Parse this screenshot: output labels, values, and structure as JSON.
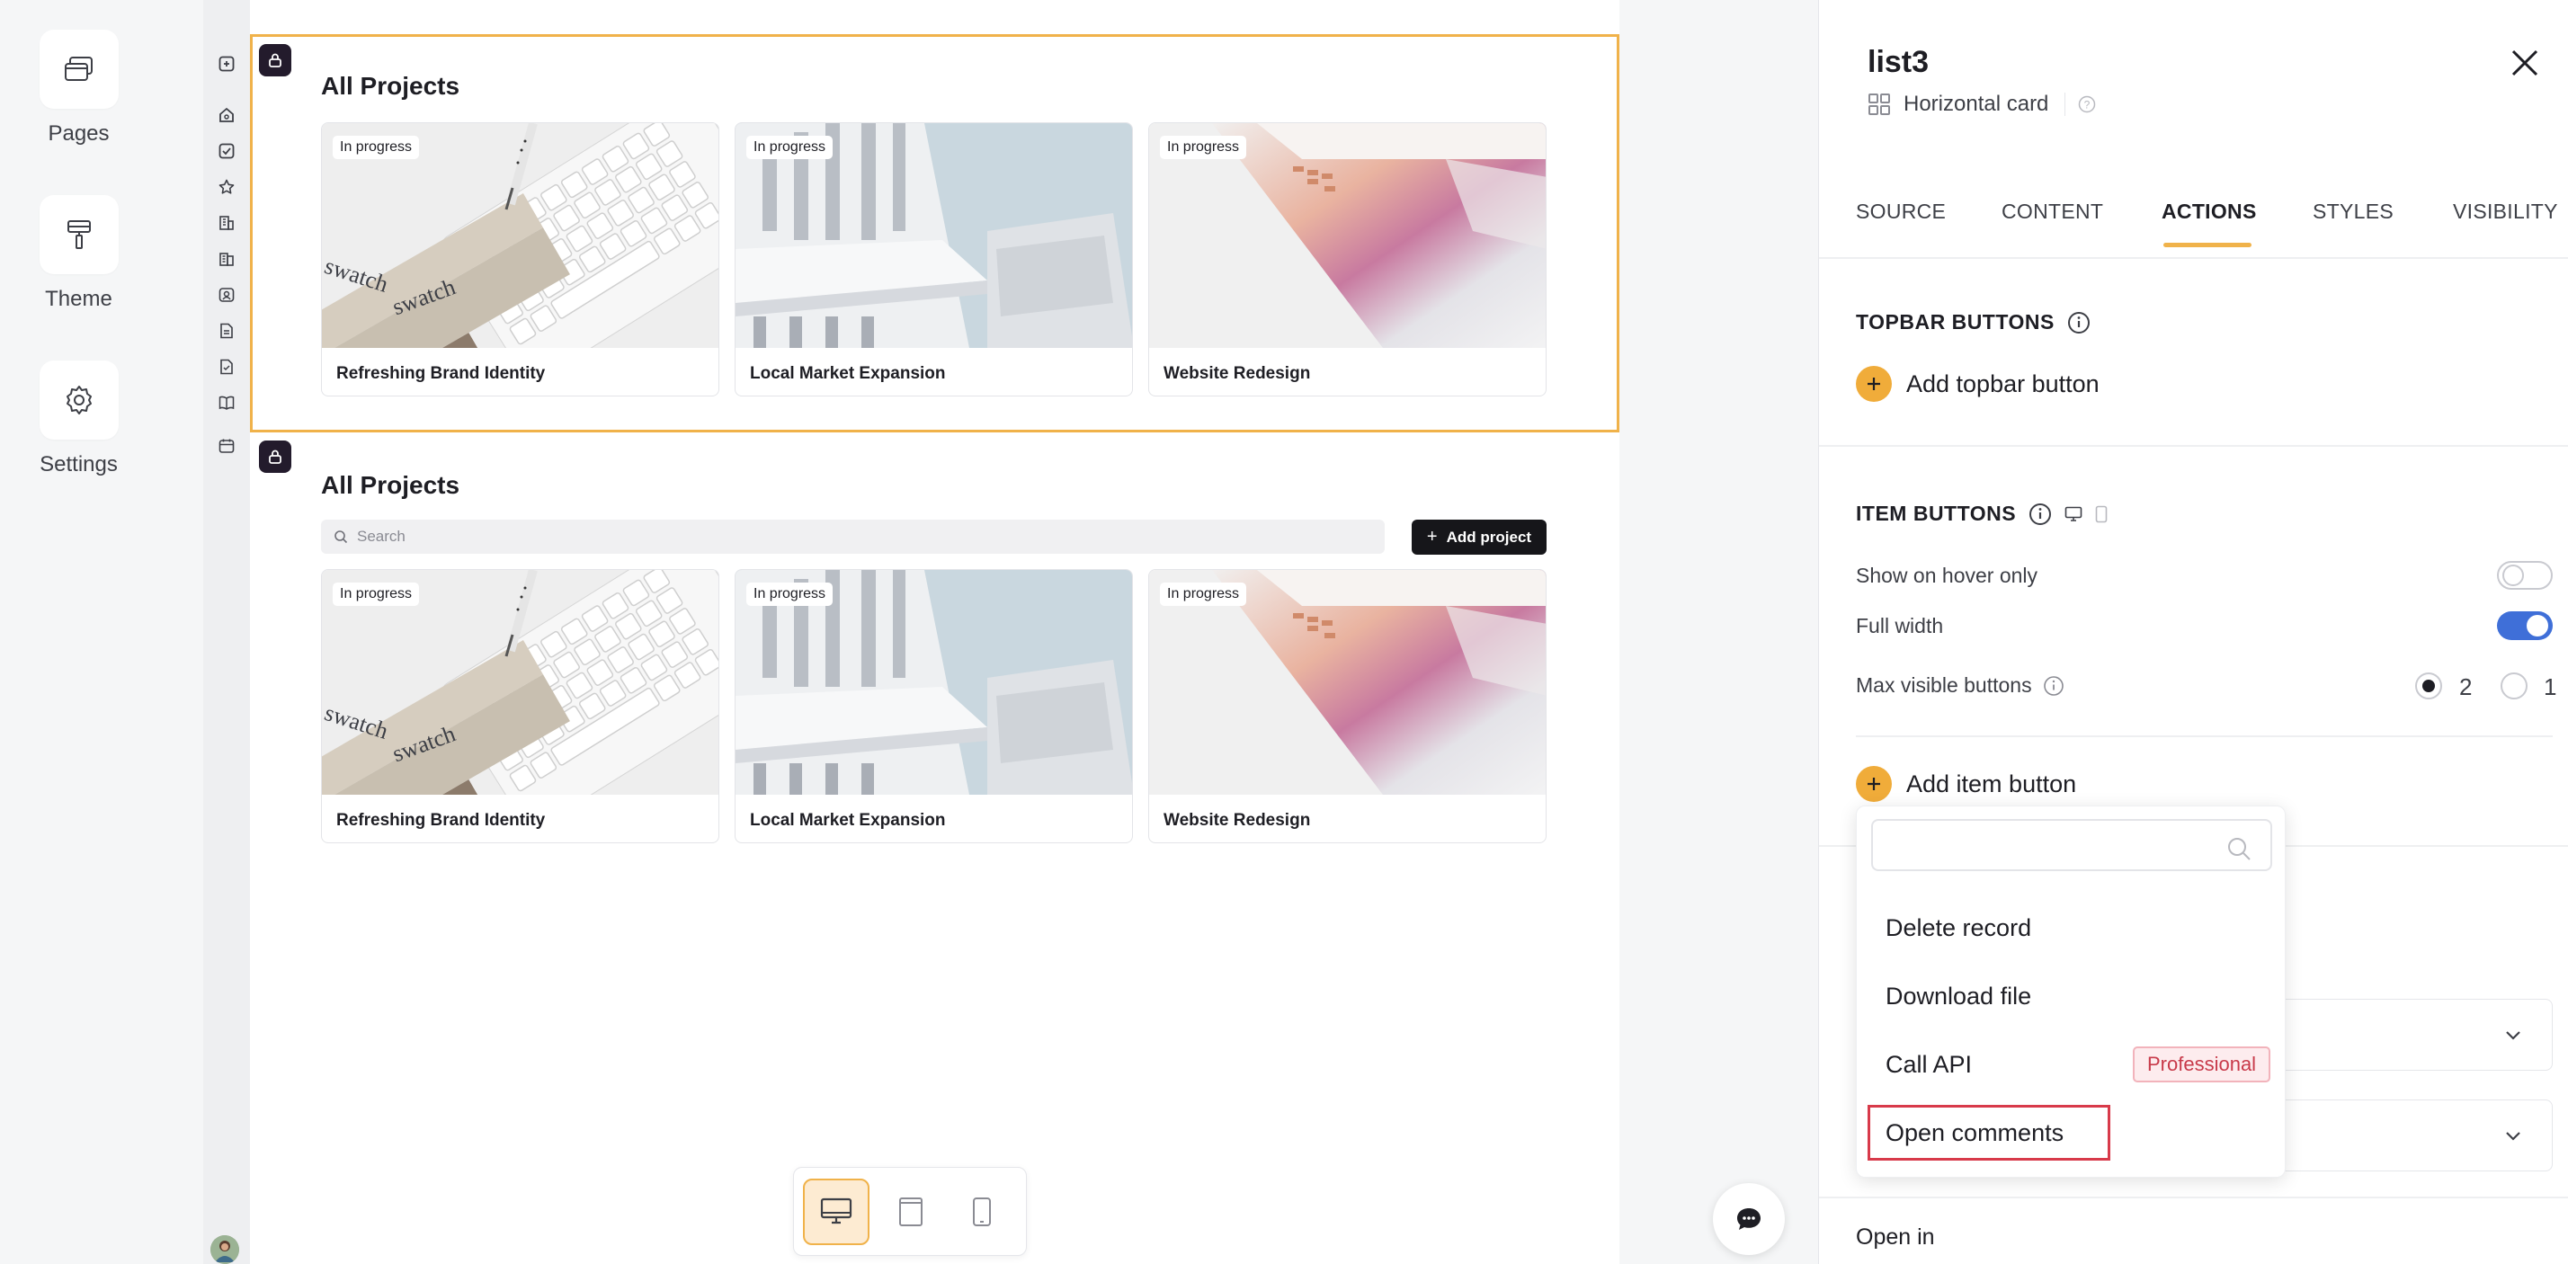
{
  "rail": {
    "pages": "Pages",
    "theme": "Theme",
    "settings": "Settings"
  },
  "blocks": [
    {
      "title": "All Projects",
      "cards": [
        {
          "badge": "In progress",
          "title": "Refreshing Brand Identity",
          "image": "keyboard-swatch-image"
        },
        {
          "badge": "In progress",
          "title": "Local Market Expansion",
          "image": "building-image"
        },
        {
          "badge": "In progress",
          "title": "Website Redesign",
          "image": "laptop-image"
        }
      ]
    },
    {
      "title": "All Projects",
      "search_placeholder": "Search",
      "add_button": "Add project",
      "cards": [
        {
          "badge": "In progress",
          "title": "Refreshing Brand Identity",
          "image": "keyboard-swatch-image"
        },
        {
          "badge": "In progress",
          "title": "Local Market Expansion",
          "image": "building-image"
        },
        {
          "badge": "In progress",
          "title": "Website Redesign",
          "image": "laptop-image"
        }
      ]
    }
  ],
  "image_text": {
    "swatch": "swatch"
  },
  "panel": {
    "title": "list3",
    "subtitle": "Horizontal card",
    "tabs": [
      "SOURCE",
      "CONTENT",
      "ACTIONS",
      "STYLES",
      "VISIBILITY"
    ],
    "active_tab": "ACTIONS",
    "topbar": {
      "heading": "TOPBAR BUTTONS",
      "add_label": "Add topbar button"
    },
    "item_buttons": {
      "heading": "ITEM BUTTONS",
      "show_on_hover_label": "Show on hover only",
      "show_on_hover": false,
      "full_width_label": "Full width",
      "full_width": true,
      "max_visible_label": "Max visible buttons",
      "max_options": [
        "2",
        "1"
      ],
      "max_selected": "2",
      "add_label": "Add item button"
    },
    "open_in_label": "Open in"
  },
  "dropdown": {
    "search_value": "",
    "items": [
      {
        "label": "Delete record"
      },
      {
        "label": "Download file"
      },
      {
        "label": "Call API",
        "badge": "Professional"
      },
      {
        "label": "Open comments",
        "highlighted": true
      }
    ]
  },
  "colors": {
    "accent": "#f0b24a",
    "toggle_on": "#3f6fd8",
    "badge_dark": "#231b2c",
    "pro_badge": "#c83a4a"
  }
}
